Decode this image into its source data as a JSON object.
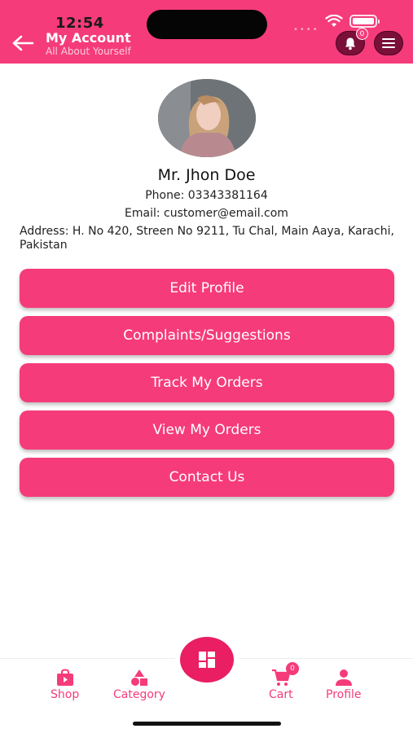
{
  "status_bar": {
    "time": "12:54"
  },
  "header": {
    "title": "My Account",
    "subtitle": "All About Yourself",
    "notification_count": "0",
    "icons": {
      "back": "back-arrow-icon",
      "bell": "bell-icon",
      "menu": "hamburger-menu-icon"
    }
  },
  "profile": {
    "name": "Mr. Jhon Doe",
    "phone": "Phone: 03343381164",
    "email": "Email: customer@email.com",
    "address": "Address: H. No 420, Streen No 9211, Tu Chal, Main Aaya, Karachi, Pakistan"
  },
  "actions": [
    {
      "label": "Edit Profile"
    },
    {
      "label": "Complaints/Suggestions"
    },
    {
      "label": "Track My Orders"
    },
    {
      "label": "View My Orders"
    },
    {
      "label": "Contact Us"
    }
  ],
  "bottom_nav": {
    "items": [
      {
        "label": "Shop",
        "icon": "shopping-bag-icon"
      },
      {
        "label": "Category",
        "icon": "category-shapes-icon"
      },
      {
        "label": "Cart",
        "icon": "cart-icon"
      },
      {
        "label": "Profile",
        "icon": "person-icon"
      }
    ],
    "cart_count": "0",
    "center_icon": "grid-icon"
  },
  "colors": {
    "accent": "#f53b7a",
    "dark_button": "#7a0f38",
    "fab": "#e91e63"
  }
}
